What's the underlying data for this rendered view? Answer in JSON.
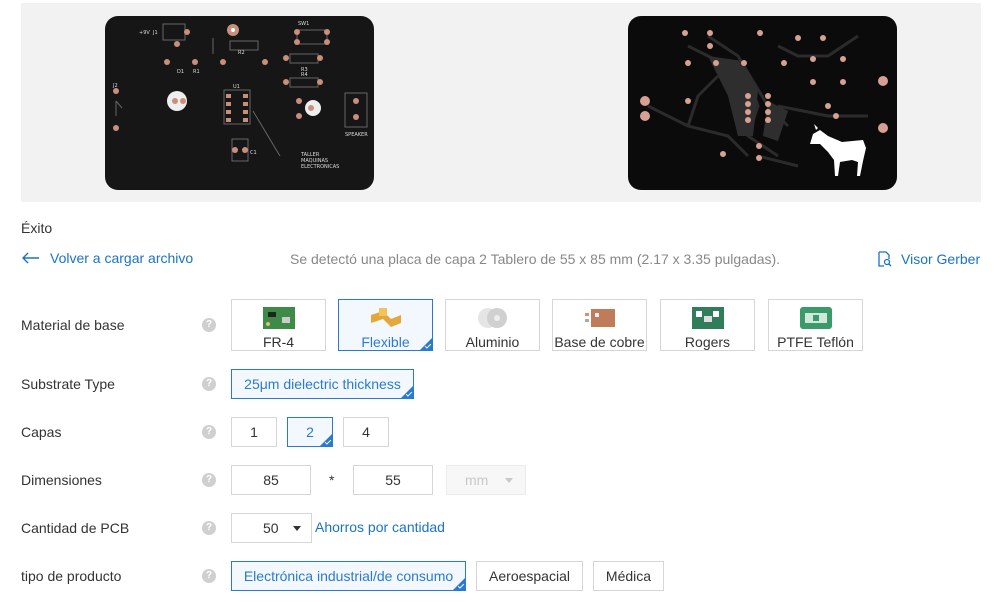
{
  "status": "Éxito",
  "back_link": "Volver a cargar archivo",
  "detection": "Se detectó una placa de capa 2 Tablero de 55 x 85 mm (2.17 x 3.35 pulgadas).",
  "gerber_link": "Visor Gerber",
  "board_top_labels": {
    "plus9v": "+9V",
    "j1": "J1",
    "sw1": "SW1",
    "r2": "R2",
    "d1": "D1",
    "r1": "R1",
    "r3": "R3",
    "r4": "R4",
    "j2": "J2",
    "u1": "U1",
    "speaker": "SPEAKER",
    "c1": "C1",
    "taller": [
      "TALLER",
      "MAQUINAS",
      "ELECTRONICAS"
    ]
  },
  "fields": {
    "material": {
      "label": "Material de base",
      "options": [
        "FR-4",
        "Flexible",
        "Aluminio",
        "Base de cobre",
        "Rogers",
        "PTFE Teflón"
      ],
      "selected": "Flexible"
    },
    "substrate": {
      "label": "Substrate Type",
      "options": [
        "25μm dielectric thickness"
      ],
      "selected": "25μm dielectric thickness"
    },
    "layers": {
      "label": "Capas",
      "options": [
        "1",
        "2",
        "4"
      ],
      "selected": "2"
    },
    "dimensions": {
      "label": "Dimensiones",
      "length": "85",
      "separator": "*",
      "width": "55",
      "unit": "mm"
    },
    "quantity": {
      "label": "Cantidad de PCB",
      "value": "50",
      "link": "Ahorros por cantidad"
    },
    "product_type": {
      "label": "tipo de producto",
      "options": [
        "Electrónica industrial/de consumo",
        "Aeroespacial",
        "Médica"
      ],
      "selected": "Electrónica industrial/de consumo"
    }
  },
  "colors": {
    "accent": "#2a7ad1",
    "link": "#1a73c9",
    "pcb_black": "#111111",
    "pad_copper": "#c98f7a"
  }
}
